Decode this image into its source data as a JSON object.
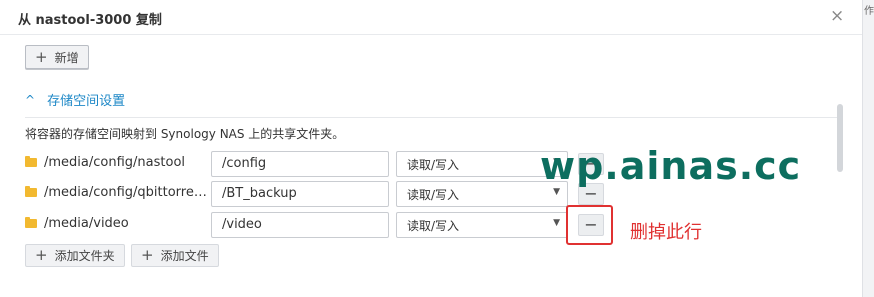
{
  "window": {
    "title": "从 nastool-3000 复制",
    "close_icon": "×",
    "side_text": "作"
  },
  "toolbar": {
    "add_label": "新增"
  },
  "section": {
    "label": "存储空间设置",
    "description": "将容器的存储空间映射到 Synology NAS 上的共享文件夹。"
  },
  "volumes": [
    {
      "path": "/media/config/nastool",
      "mount": "/config",
      "permission": "读取/写入"
    },
    {
      "path": "/media/config/qbittorrent...",
      "mount": "/BT_backup",
      "permission": "读取/写入"
    },
    {
      "path": "/media/video",
      "mount": "/video",
      "permission": "读取/写入"
    }
  ],
  "actions": {
    "add_folder": "添加文件夹",
    "add_file": "添加文件"
  },
  "overlay": {
    "watermark": "wp.ainas.cc",
    "annotation": "删掉此行",
    "highlight_color": "#e03131"
  },
  "colors": {
    "accent": "#1e88c7",
    "folder": "#f2b930",
    "watermark": "#0d6e5f"
  }
}
